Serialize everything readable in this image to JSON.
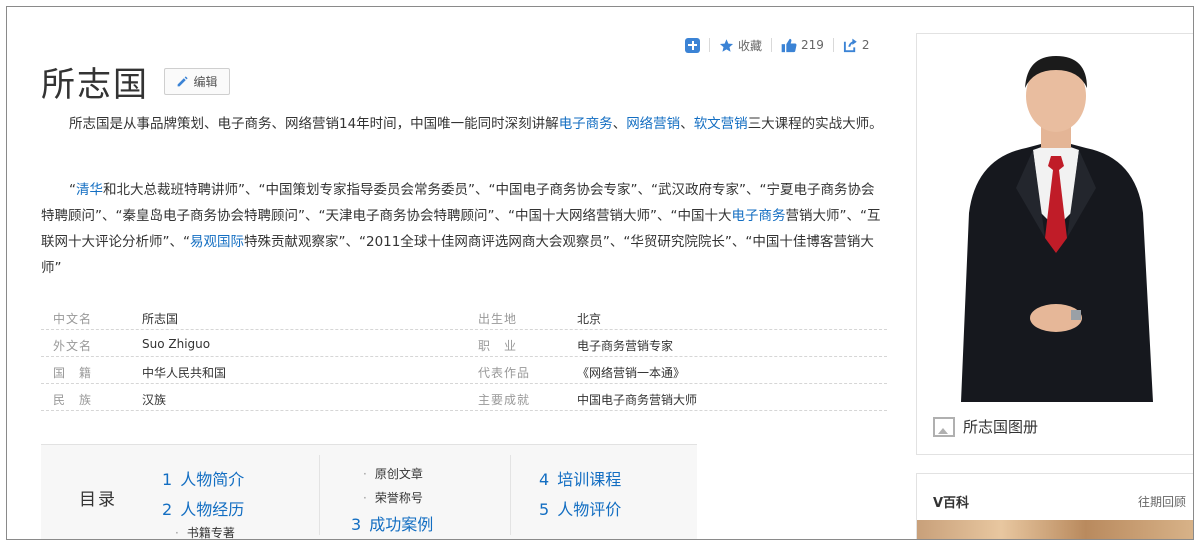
{
  "actions": {
    "favorite_label": "收藏",
    "like_count": "219",
    "share_count": "2"
  },
  "header": {
    "title": "所志国",
    "edit_label": "编辑"
  },
  "intro": {
    "p1": [
      "所志国是从事品牌策划、电子商务、网络营销14年时间，中国唯一能同时深刻讲解",
      "电子商务",
      "、",
      "网络营销",
      "、",
      "软文营销",
      "三大课程的实战大师。"
    ],
    "p2": [
      "“",
      "清华",
      "和北大总裁班特聘讲师”、“中国策划专家指导委员会常务委员”、“中国电子商务协会专家”、“武汉政府专家”、“宁夏电子商务协会特聘顾问”、“秦皇岛电子商务协会特聘顾问”、“天津电子商务协会特聘顾问”、“中国十大网络营销大师”、“中国十大",
      "电子商务",
      "营销大师”、“互联网十大评论分析师”、“",
      "易观国际",
      "特殊贡献观察家”、“2011全球十佳网商评选网商大会观察员”、“华贸研究院院长”、“中国十佳博客营销大师”"
    ]
  },
  "info": [
    {
      "l1": "中文名",
      "v1": "所志国",
      "l2": "出生地",
      "v2": "北京"
    },
    {
      "l1": "外文名",
      "v1": "Suo Zhiguo",
      "l2": "职　业",
      "v2": "电子商务营销专家"
    },
    {
      "l1": "国　籍",
      "v1": "中华人民共和国",
      "l2": "代表作品",
      "v2": "《网络营销一本通》"
    },
    {
      "l1": "民　族",
      "v1": "汉族",
      "l2": "主要成就",
      "v2": "中国电子商务营销大师"
    }
  ],
  "catalog": {
    "title": "目录",
    "items": [
      {
        "num": "1",
        "label": "人物简介"
      },
      {
        "num": "2",
        "label": "人物经历"
      },
      {
        "num": "3",
        "label": "成功案例"
      },
      {
        "num": "4",
        "label": "培训课程"
      },
      {
        "num": "5",
        "label": "人物评价"
      }
    ],
    "subs": [
      "书籍专著",
      "原创文章",
      "荣誉称号"
    ]
  },
  "sidebar": {
    "album_label": "所志国图册",
    "vbaike_title": "V百科",
    "vbaike_more": "往期回顾"
  }
}
